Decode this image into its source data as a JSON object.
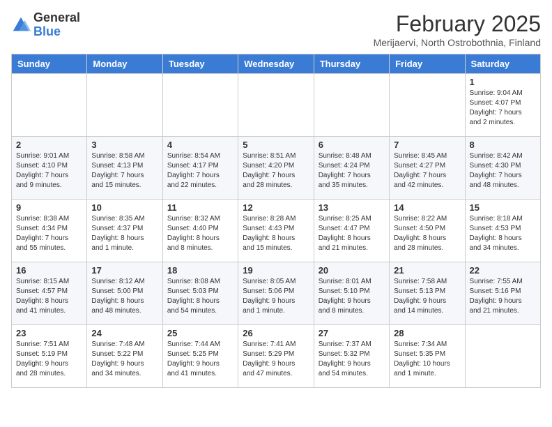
{
  "header": {
    "logo": {
      "general": "General",
      "blue": "Blue"
    },
    "title": "February 2025",
    "location": "Merijaervi, North Ostrobothnia, Finland"
  },
  "weekdays": [
    "Sunday",
    "Monday",
    "Tuesday",
    "Wednesday",
    "Thursday",
    "Friday",
    "Saturday"
  ],
  "weeks": [
    [
      {
        "day": "",
        "info": ""
      },
      {
        "day": "",
        "info": ""
      },
      {
        "day": "",
        "info": ""
      },
      {
        "day": "",
        "info": ""
      },
      {
        "day": "",
        "info": ""
      },
      {
        "day": "",
        "info": ""
      },
      {
        "day": "1",
        "info": "Sunrise: 9:04 AM\nSunset: 4:07 PM\nDaylight: 7 hours\nand 2 minutes."
      }
    ],
    [
      {
        "day": "2",
        "info": "Sunrise: 9:01 AM\nSunset: 4:10 PM\nDaylight: 7 hours\nand 9 minutes."
      },
      {
        "day": "3",
        "info": "Sunrise: 8:58 AM\nSunset: 4:13 PM\nDaylight: 7 hours\nand 15 minutes."
      },
      {
        "day": "4",
        "info": "Sunrise: 8:54 AM\nSunset: 4:17 PM\nDaylight: 7 hours\nand 22 minutes."
      },
      {
        "day": "5",
        "info": "Sunrise: 8:51 AM\nSunset: 4:20 PM\nDaylight: 7 hours\nand 28 minutes."
      },
      {
        "day": "6",
        "info": "Sunrise: 8:48 AM\nSunset: 4:24 PM\nDaylight: 7 hours\nand 35 minutes."
      },
      {
        "day": "7",
        "info": "Sunrise: 8:45 AM\nSunset: 4:27 PM\nDaylight: 7 hours\nand 42 minutes."
      },
      {
        "day": "8",
        "info": "Sunrise: 8:42 AM\nSunset: 4:30 PM\nDaylight: 7 hours\nand 48 minutes."
      }
    ],
    [
      {
        "day": "9",
        "info": "Sunrise: 8:38 AM\nSunset: 4:34 PM\nDaylight: 7 hours\nand 55 minutes."
      },
      {
        "day": "10",
        "info": "Sunrise: 8:35 AM\nSunset: 4:37 PM\nDaylight: 8 hours\nand 1 minute."
      },
      {
        "day": "11",
        "info": "Sunrise: 8:32 AM\nSunset: 4:40 PM\nDaylight: 8 hours\nand 8 minutes."
      },
      {
        "day": "12",
        "info": "Sunrise: 8:28 AM\nSunset: 4:43 PM\nDaylight: 8 hours\nand 15 minutes."
      },
      {
        "day": "13",
        "info": "Sunrise: 8:25 AM\nSunset: 4:47 PM\nDaylight: 8 hours\nand 21 minutes."
      },
      {
        "day": "14",
        "info": "Sunrise: 8:22 AM\nSunset: 4:50 PM\nDaylight: 8 hours\nand 28 minutes."
      },
      {
        "day": "15",
        "info": "Sunrise: 8:18 AM\nSunset: 4:53 PM\nDaylight: 8 hours\nand 34 minutes."
      }
    ],
    [
      {
        "day": "16",
        "info": "Sunrise: 8:15 AM\nSunset: 4:57 PM\nDaylight: 8 hours\nand 41 minutes."
      },
      {
        "day": "17",
        "info": "Sunrise: 8:12 AM\nSunset: 5:00 PM\nDaylight: 8 hours\nand 48 minutes."
      },
      {
        "day": "18",
        "info": "Sunrise: 8:08 AM\nSunset: 5:03 PM\nDaylight: 8 hours\nand 54 minutes."
      },
      {
        "day": "19",
        "info": "Sunrise: 8:05 AM\nSunset: 5:06 PM\nDaylight: 9 hours\nand 1 minute."
      },
      {
        "day": "20",
        "info": "Sunrise: 8:01 AM\nSunset: 5:10 PM\nDaylight: 9 hours\nand 8 minutes."
      },
      {
        "day": "21",
        "info": "Sunrise: 7:58 AM\nSunset: 5:13 PM\nDaylight: 9 hours\nand 14 minutes."
      },
      {
        "day": "22",
        "info": "Sunrise: 7:55 AM\nSunset: 5:16 PM\nDaylight: 9 hours\nand 21 minutes."
      }
    ],
    [
      {
        "day": "23",
        "info": "Sunrise: 7:51 AM\nSunset: 5:19 PM\nDaylight: 9 hours\nand 28 minutes."
      },
      {
        "day": "24",
        "info": "Sunrise: 7:48 AM\nSunset: 5:22 PM\nDaylight: 9 hours\nand 34 minutes."
      },
      {
        "day": "25",
        "info": "Sunrise: 7:44 AM\nSunset: 5:25 PM\nDaylight: 9 hours\nand 41 minutes."
      },
      {
        "day": "26",
        "info": "Sunrise: 7:41 AM\nSunset: 5:29 PM\nDaylight: 9 hours\nand 47 minutes."
      },
      {
        "day": "27",
        "info": "Sunrise: 7:37 AM\nSunset: 5:32 PM\nDaylight: 9 hours\nand 54 minutes."
      },
      {
        "day": "28",
        "info": "Sunrise: 7:34 AM\nSunset: 5:35 PM\nDaylight: 10 hours\nand 1 minute."
      },
      {
        "day": "",
        "info": ""
      }
    ]
  ]
}
